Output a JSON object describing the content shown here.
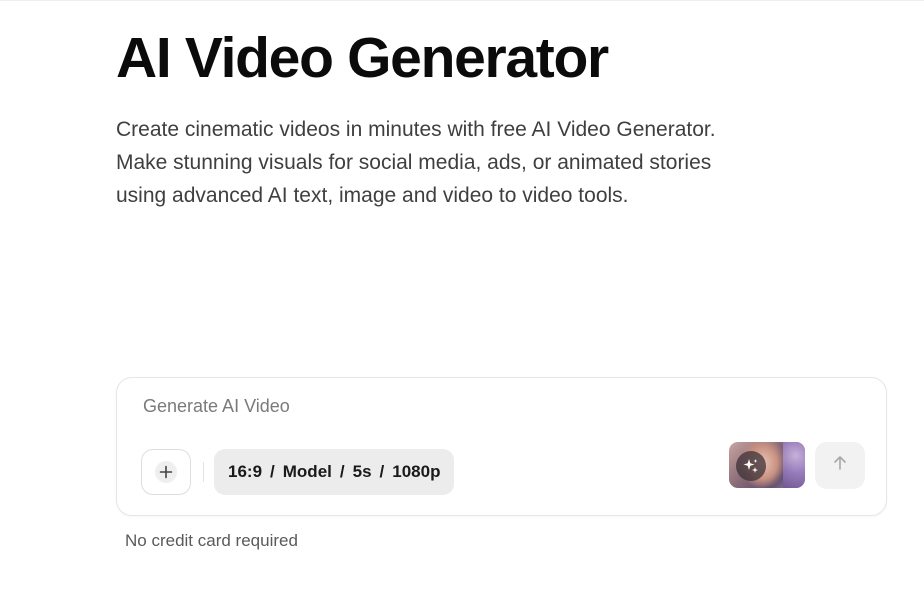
{
  "hero": {
    "title": "AI Video Generator",
    "description_lines": [
      "Create cinematic videos in minutes with free AI Video Generator.",
      "Make stunning visuals for social media, ads, or animated stories",
      "using advanced AI text, image and video to video tools."
    ]
  },
  "prompt": {
    "placeholder": "Generate AI Video",
    "add_icon": "plus-icon",
    "settings": {
      "aspect_ratio": "16:9",
      "model": "Model",
      "duration": "5s",
      "resolution": "1080p",
      "separator": "/"
    },
    "thumbnail_icon": "sparkle-icon",
    "send_icon": "arrow-up-icon"
  },
  "note": "No credit card required",
  "colors": {
    "pill_background": "#ececec",
    "send_background": "#f2f2f2",
    "title_color": "#0b0b0b"
  }
}
